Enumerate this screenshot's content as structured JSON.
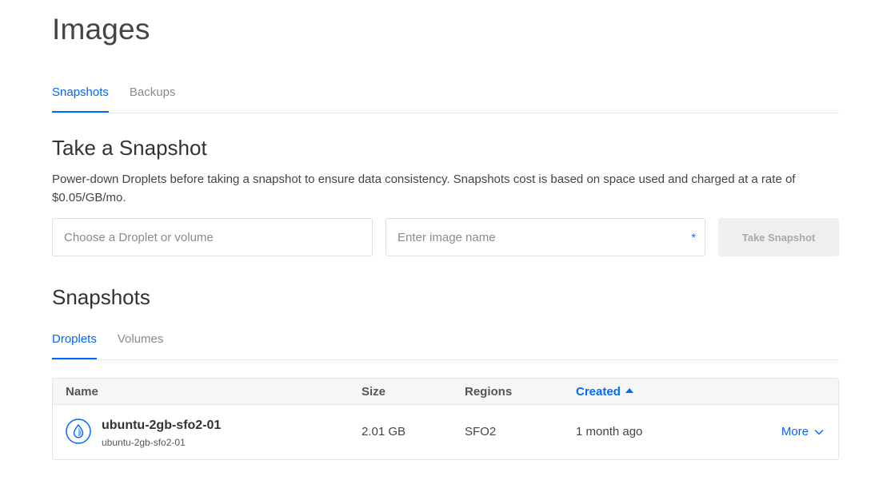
{
  "page": {
    "title": "Images"
  },
  "tabs": [
    {
      "label": "Snapshots",
      "active": true
    },
    {
      "label": "Backups",
      "active": false
    }
  ],
  "take_snapshot": {
    "heading": "Take a Snapshot",
    "description": "Power-down Droplets before taking a snapshot to ensure data consistency. Snapshots cost is based on space used and charged at a rate of $0.05/GB/mo.",
    "droplet_select_placeholder": "Choose a Droplet or volume",
    "image_name_placeholder": "Enter image name",
    "required_marker": "*",
    "button_label": "Take Snapshot"
  },
  "snapshots": {
    "heading": "Snapshots",
    "tabs": [
      {
        "label": "Droplets",
        "active": true
      },
      {
        "label": "Volumes",
        "active": false
      }
    ],
    "columns": {
      "name": "Name",
      "size": "Size",
      "regions": "Regions",
      "created": "Created"
    },
    "sort": {
      "column": "created",
      "direction": "asc"
    },
    "rows": [
      {
        "name": "ubuntu-2gb-sfo2-01",
        "subtitle": "ubuntu-2gb-sfo2-01",
        "size": "2.01 GB",
        "region": "SFO2",
        "created": "1 month ago",
        "action_label": "More",
        "icon": "droplet-icon"
      }
    ]
  },
  "colors": {
    "accent": "#0069ff",
    "muted_tab": "#8b8b8b",
    "disabled_button_bg": "#efefef",
    "disabled_button_text": "#a9a9a9"
  }
}
